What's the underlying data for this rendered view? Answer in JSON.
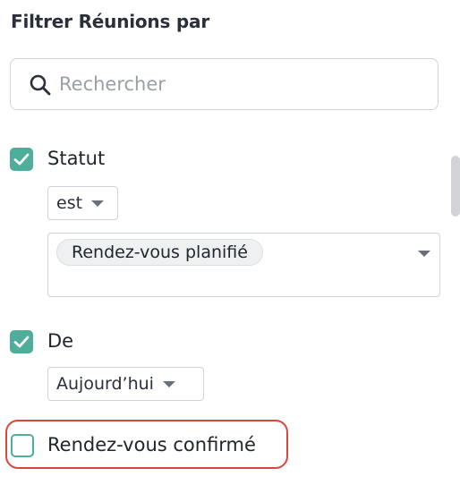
{
  "panel": {
    "title": "Filtrer Réunions par"
  },
  "search": {
    "placeholder": "Rechercher",
    "value": ""
  },
  "filters": {
    "statut": {
      "label": "Statut",
      "checked": true,
      "operator": "est",
      "selected_chip": "Rendez-vous planifié"
    },
    "de": {
      "label": "De",
      "checked": true,
      "value": "Aujourd’hui"
    },
    "confirme": {
      "label": "Rendez-vous confirmé",
      "checked": false,
      "highlighted": true
    }
  },
  "colors": {
    "accent": "#4fae9a",
    "highlight": "#d9473a",
    "border": "#cfd3d9",
    "chip_bg": "#eef0f2"
  },
  "icons": {
    "search": "search-icon",
    "check": "check-icon",
    "caret": "caret-down-icon"
  }
}
